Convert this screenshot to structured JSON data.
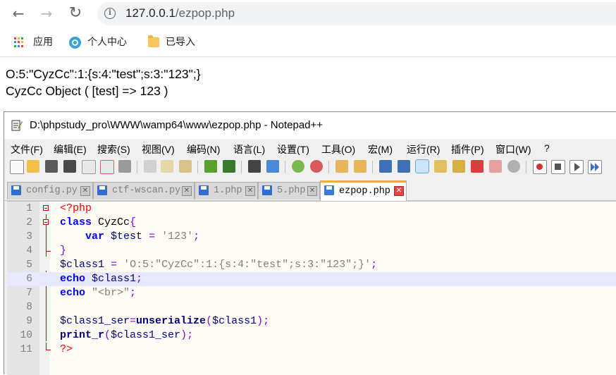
{
  "browser": {
    "address": {
      "host": "127.0.0.1",
      "path": "/ezpop.php"
    },
    "bookmarks": [
      {
        "label": "应用",
        "icon": "apps-grid-icon"
      },
      {
        "label": "个人中心",
        "icon": "globe-icon"
      },
      {
        "label": "已导入",
        "icon": "folder-icon"
      }
    ]
  },
  "page_output": {
    "line1": "O:5:\"CyzCc\":1:{s:4:\"test\";s:3:\"123\";}",
    "line2": "CyzCc Object ( [test] => 123 )"
  },
  "notepad": {
    "title": "D:\\phpstudy_pro\\WWW\\wamp64\\www\\ezpop.php - Notepad++",
    "menu": [
      "文件(F)",
      "编辑(E)",
      "搜索(S)",
      "视图(V)",
      "编码(N)",
      "语言(L)",
      "设置(T)",
      "工具(O)",
      "宏(M)",
      "运行(R)",
      "插件(P)",
      "窗口(W)",
      "?"
    ],
    "tabs": [
      {
        "label": "config.py",
        "active": false
      },
      {
        "label": "ctf-wscan.py",
        "active": false
      },
      {
        "label": "1.php",
        "active": false
      },
      {
        "label": "5.php",
        "active": false
      },
      {
        "label": "ezpop.php",
        "active": true
      }
    ],
    "code": {
      "line_numbers": [
        "1",
        "2",
        "3",
        "4",
        "5",
        "6",
        "7",
        "8",
        "9",
        "10",
        "11"
      ],
      "l1": {
        "tag": "<?php"
      },
      "l2": {
        "kw": "class",
        "name": "CyzCc",
        "brace": "{"
      },
      "l3": {
        "kw": "var",
        "var": "$test",
        "op": "=",
        "str": "'123'",
        "semi": ";"
      },
      "l4": {
        "brace": "}"
      },
      "l5": {
        "var": "$class1",
        "op": "=",
        "str": "'O:5:\"CyzCc\":1:{s:4:\"test\";s:3:\"123\";}'",
        "semi": ";"
      },
      "l6": {
        "kw": "echo",
        "var": "$class1",
        "semi": ";"
      },
      "l7": {
        "kw": "echo",
        "str": "\"<br>\"",
        "semi": ";"
      },
      "l9": {
        "var": "$class1_ser",
        "op": "=",
        "fn": "unserialize",
        "open": "(",
        "arg": "$class1",
        "close": ");"
      },
      "l10": {
        "fn": "print_r",
        "open": "(",
        "arg": "$class1_ser",
        "close": ");"
      },
      "l11": {
        "tag": "?>"
      }
    }
  }
}
